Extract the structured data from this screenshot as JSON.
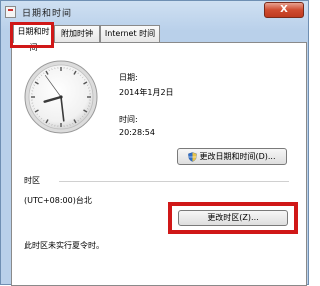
{
  "window": {
    "title": "日期和时间",
    "close_glyph": "X"
  },
  "tabs": [
    {
      "label": "日期和时间",
      "active": true
    },
    {
      "label": "附加时钟",
      "active": false
    },
    {
      "label": "Internet 时间",
      "active": false
    }
  ],
  "datetime": {
    "date_label": "日期:",
    "date_value": "2014年1月2日",
    "time_label": "时间:",
    "time_value": "20:28:54",
    "change_datetime_button": "更改日期和时间(D)...",
    "clock": {
      "hours": 20,
      "minutes": 28,
      "seconds": 54
    }
  },
  "timezone": {
    "section_label": "时区",
    "value": "(UTC+08:00)台北",
    "change_timezone_button": "更改时区(Z)...",
    "dst_note": "此时区未实行夏令时。"
  },
  "colors": {
    "highlight": "#d01818",
    "titlebar": "#b9d0ea"
  },
  "icons": [
    "calendar-icon",
    "close-icon",
    "shield-icon"
  ]
}
